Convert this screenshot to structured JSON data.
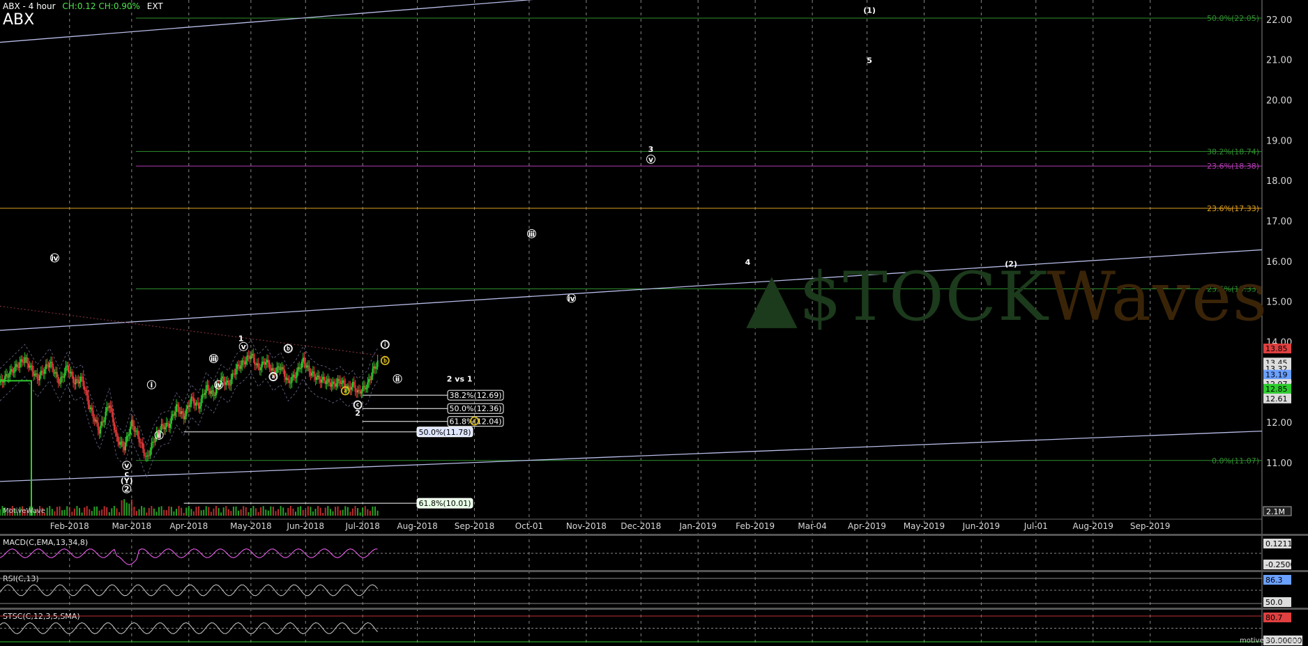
{
  "header": {
    "ticker_line": "ABX - 4 hour",
    "change": "CH:0.12  CH:0.90%",
    "session": "EXT",
    "symbol": "ABX"
  },
  "watermark": {
    "part1": "▲$TOCK",
    "part2": "W",
    "part3": "aves"
  },
  "footer": {
    "left_brand": "MotiveWave",
    "right_brand": "motivewave.com"
  },
  "colors": {
    "background": "#000000",
    "up_candle": "#2ecc2e",
    "down_candle": "#e83a3a",
    "channel_line": "#b8bde8",
    "fib_green": "#2f8f2f",
    "fib_magenta": "#b33cb3",
    "fib_orange": "#e0a020",
    "price_tag_red": "#e04040",
    "macd_line": "#ff66ff",
    "macd_hist": "#5fb8e8"
  },
  "chart_data": {
    "type": "candlestick",
    "title": "ABX - 4 hour",
    "y_axis": {
      "ylim": [
        9.7,
        22.5
      ],
      "ticks": [
        11.0,
        12.0,
        13.0,
        14.0,
        15.0,
        16.0,
        17.0,
        18.0,
        19.0,
        20.0,
        21.0,
        22.0
      ]
    },
    "x_axis": {
      "tick_labels": [
        "Feb-2018",
        "Mar-2018",
        "Apr-2018",
        "May-2018",
        "Jun-2018",
        "Jul-2018",
        "Aug-2018",
        "Sep-2018",
        "Oct-01",
        "Nov-2018",
        "Dec-2018",
        "Jan-2019",
        "Feb-2019",
        "Mar-04",
        "Apr-2019",
        "May-2019",
        "Jun-2019",
        "Jul-01",
        "Aug-2019",
        "Sep-2019"
      ],
      "index_range": [
        -18,
        490
      ],
      "tick_index": [
        10,
        35,
        58,
        83,
        105,
        128,
        150,
        173,
        195,
        218,
        240,
        263,
        286,
        309,
        331,
        354,
        377,
        399,
        422,
        445
      ]
    },
    "price_path": [
      [
        -18,
        13.0
      ],
      [
        -13,
        13.3
      ],
      [
        -8,
        13.6
      ],
      [
        -3,
        13.1
      ],
      [
        2,
        13.5
      ],
      [
        6,
        13.0
      ],
      [
        9,
        13.4
      ],
      [
        12,
        13.0
      ],
      [
        15,
        13.1
      ],
      [
        18,
        12.4
      ],
      [
        22,
        11.8
      ],
      [
        26,
        12.5
      ],
      [
        29,
        11.6
      ],
      [
        32,
        11.4
      ],
      [
        35,
        12.0
      ],
      [
        38,
        11.6
      ],
      [
        41,
        11.1
      ],
      [
        44,
        11.6
      ],
      [
        47,
        11.9
      ],
      [
        50,
        11.95
      ],
      [
        53,
        12.4
      ],
      [
        56,
        12.15
      ],
      [
        59,
        12.6
      ],
      [
        62,
        12.4
      ],
      [
        65,
        12.9
      ],
      [
        68,
        12.7
      ],
      [
        71,
        13.1
      ],
      [
        74,
        12.95
      ],
      [
        77,
        13.35
      ],
      [
        80,
        13.5
      ],
      [
        83,
        13.7
      ],
      [
        86,
        13.35
      ],
      [
        89,
        13.55
      ],
      [
        92,
        13.25
      ],
      [
        95,
        13.4
      ],
      [
        98,
        13.0
      ],
      [
        101,
        13.2
      ],
      [
        104,
        13.55
      ],
      [
        107,
        13.25
      ],
      [
        110,
        13.1
      ],
      [
        113,
        13.05
      ],
      [
        116,
        12.95
      ],
      [
        119,
        13.05
      ],
      [
        122,
        12.85
      ],
      [
        124,
        12.95
      ],
      [
        126,
        12.75
      ],
      [
        128,
        12.85
      ],
      [
        130,
        12.95
      ],
      [
        132,
        13.3
      ],
      [
        134,
        13.5
      ]
    ],
    "last_price": 13.45,
    "right_axis_tags": [
      {
        "label": "13.85",
        "y": 13.85,
        "color": "#e04040"
      },
      {
        "label": "13.45",
        "y": 13.5,
        "color": "#dddddd"
      },
      {
        "label": "13.32",
        "y": 13.35,
        "color": "#dddddd"
      },
      {
        "label": "13.19",
        "y": 13.2,
        "color": "#6aa0ff"
      },
      {
        "label": "12.97",
        "y": 12.97,
        "color": "#dddddd"
      },
      {
        "label": "12.85",
        "y": 12.85,
        "color": "#2ecc2e"
      },
      {
        "label": "12.61",
        "y": 12.61,
        "color": "#dddddd"
      }
    ],
    "fib_levels": [
      {
        "label": "50.0%(22.05)",
        "y": 22.05,
        "color": "#2f8f2f"
      },
      {
        "label": "38.2%(18.74)",
        "y": 18.74,
        "color": "#2f8f2f"
      },
      {
        "label": "23.6%(18.38)",
        "y": 18.38,
        "color": "#b33cb3"
      },
      {
        "label": "23.6%(17.33)",
        "y": 17.33,
        "color": "#e0a020"
      },
      {
        "label": "23.6%(15.33)",
        "y": 15.33,
        "color": "#2f8f2f"
      },
      {
        "label": "0.0%(11.07)",
        "y": 11.07,
        "color": "#2f8f2f"
      }
    ],
    "retracement_boxes": [
      {
        "label": "38.2%(12.69)",
        "y": 12.69,
        "start_index": 128
      },
      {
        "label": "50.0%(12.36)",
        "y": 12.36,
        "start_index": 128
      },
      {
        "label": "61.8%(12.04)",
        "y": 12.04,
        "start_index": 128
      },
      {
        "label": "50.0%(11.78)",
        "y": 11.78,
        "start_index": 56
      },
      {
        "label": "61.8%(10.01)",
        "y": 10.01,
        "start_index": 56
      }
    ],
    "trend_lines": [
      {
        "from": [
          -18,
          21.45
        ],
        "to": [
          245,
          22.75
        ]
      },
      {
        "from": [
          -18,
          14.3
        ],
        "to": [
          490,
          16.3
        ]
      },
      {
        "from": [
          -18,
          10.55
        ],
        "to": [
          490,
          11.8
        ]
      }
    ],
    "wave_labels": [
      {
        "text": "ⅳ",
        "index": 4,
        "y": 16.1,
        "circle": true
      },
      {
        "text": "ⅴ",
        "index": 33,
        "y": 10.95,
        "circle": true
      },
      {
        "text": "c",
        "index": 33,
        "y": 10.75,
        "circle": false
      },
      {
        "text": "(Y)",
        "index": 33,
        "y": 10.57,
        "circle": false
      },
      {
        "text": "2",
        "index": 33,
        "y": 10.37,
        "circle": true
      },
      {
        "text": "ⅰ",
        "index": 43,
        "y": 12.95,
        "circle": true
      },
      {
        "text": "ⅱ",
        "index": 46,
        "y": 11.7,
        "circle": true
      },
      {
        "text": "ⅲ",
        "index": 68,
        "y": 13.6,
        "circle": true
      },
      {
        "text": "ⅳ",
        "index": 70,
        "y": 12.95,
        "circle": true
      },
      {
        "text": "1",
        "index": 79,
        "y": 14.1,
        "circle": false
      },
      {
        "text": "ⅴ",
        "index": 80,
        "y": 13.9,
        "circle": true
      },
      {
        "text": "ⓑ",
        "index": 98,
        "y": 13.85,
        "circle": true
      },
      {
        "text": "ⓐ",
        "index": 92,
        "y": 13.15,
        "circle": true
      },
      {
        "text": "ⓐ",
        "index": 121,
        "y": 12.8,
        "circle": true
      },
      {
        "text": "ⓒ",
        "index": 126,
        "y": 12.45,
        "circle": true
      },
      {
        "text": "2",
        "index": 126,
        "y": 12.25,
        "circle": false
      },
      {
        "text": "ⓘ",
        "index": 137,
        "y": 13.95,
        "circle": true
      },
      {
        "text": "ⓑ",
        "index": 137,
        "y": 13.55,
        "circle": true
      },
      {
        "text": "ⅱ",
        "index": 142,
        "y": 13.1,
        "circle": true
      },
      {
        "text": "2 vs 1",
        "index": 167,
        "y": 13.1,
        "circle": false
      },
      {
        "text": "ⓒ",
        "index": 173,
        "y": 12.05,
        "circle": true
      },
      {
        "text": "ⅲ",
        "index": 196,
        "y": 16.7,
        "circle": true
      },
      {
        "text": "ⅳ",
        "index": 212,
        "y": 15.1,
        "circle": true
      },
      {
        "text": "3",
        "index": 244,
        "y": 18.8,
        "circle": false
      },
      {
        "text": "ⅴ",
        "index": 244,
        "y": 18.55,
        "circle": true
      },
      {
        "text": "4",
        "index": 283,
        "y": 16.0,
        "circle": false
      },
      {
        "text": "(1)",
        "index": 332,
        "y": 22.25,
        "circle": false
      },
      {
        "text": "5",
        "index": 332,
        "y": 21.0,
        "circle": false
      },
      {
        "text": "(2)",
        "index": 389,
        "y": 15.95,
        "circle": false
      }
    ],
    "volume_label": "2.1M",
    "indicators": [
      {
        "name": "MACD(C,EMA,13,34,8)",
        "ticks": [
          "0.1211",
          "-0.2500"
        ],
        "ylim": [
          -0.55,
          0.25
        ]
      },
      {
        "name": "RSI(C,13)",
        "ticks": [
          "86.3",
          "50.0"
        ],
        "ylim": [
          0,
          100
        ]
      },
      {
        "name": "STSC(C,12,3,5,SMA)",
        "ticks": [
          "80.7",
          "30.00000"
        ],
        "ylim": [
          0,
          100
        ]
      }
    ]
  }
}
